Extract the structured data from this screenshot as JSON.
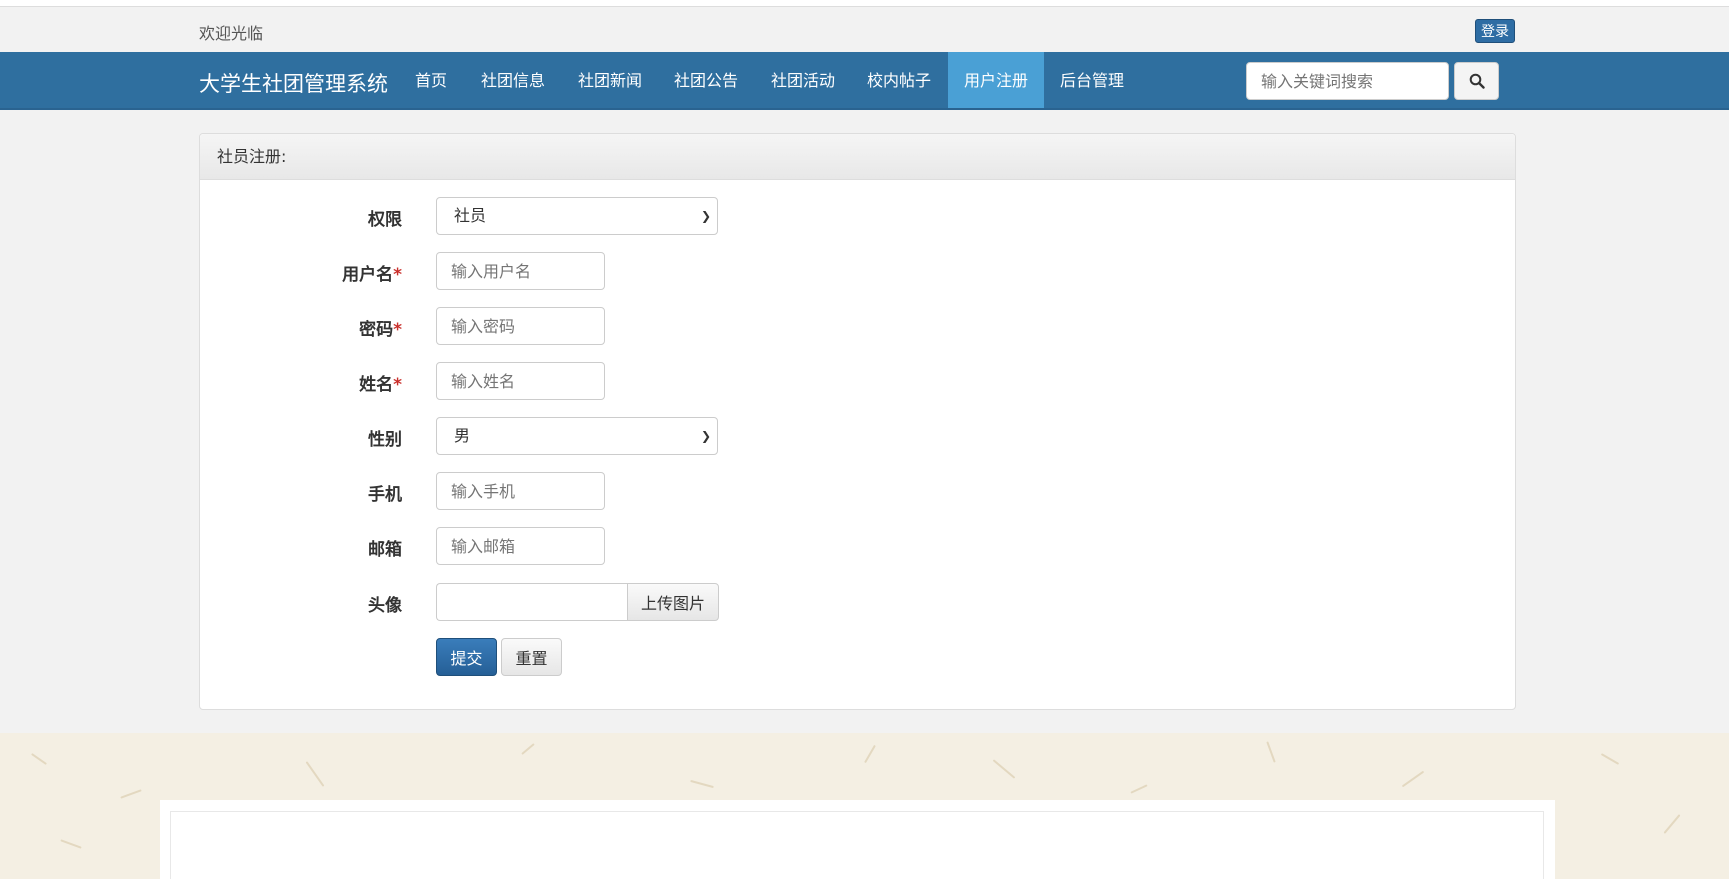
{
  "header": {
    "welcome": "欢迎光临",
    "login_label": "登录"
  },
  "navbar": {
    "brand": "大学生社团管理系统",
    "items": [
      {
        "label": "首页"
      },
      {
        "label": "社团信息"
      },
      {
        "label": "社团新闻"
      },
      {
        "label": "社团公告"
      },
      {
        "label": "社团活动"
      },
      {
        "label": "校内帖子"
      },
      {
        "label": "用户注册",
        "active": true
      },
      {
        "label": "后台管理"
      }
    ],
    "search_placeholder": "输入关键词搜索",
    "search_icon": "search-icon"
  },
  "form": {
    "title": "社员注册:",
    "fields": {
      "role": {
        "label": "权限",
        "value": "社员"
      },
      "username": {
        "label": "用户名",
        "required": "*",
        "placeholder": "输入用户名"
      },
      "password": {
        "label": "密码",
        "required": "*",
        "placeholder": "输入密码"
      },
      "name": {
        "label": "姓名",
        "required": "*",
        "placeholder": "输入姓名"
      },
      "gender": {
        "label": "性别",
        "value": "男"
      },
      "phone": {
        "label": "手机",
        "placeholder": "输入手机"
      },
      "email": {
        "label": "邮箱",
        "placeholder": "输入邮箱"
      },
      "avatar": {
        "label": "头像",
        "button": "上传图片"
      }
    },
    "submit_label": "提交",
    "reset_label": "重置"
  },
  "colors": {
    "navbar": "#2f6f9f",
    "nav_active": "#4aa0d5",
    "primary_button": "#2e6da4",
    "required": "#c9302c"
  }
}
